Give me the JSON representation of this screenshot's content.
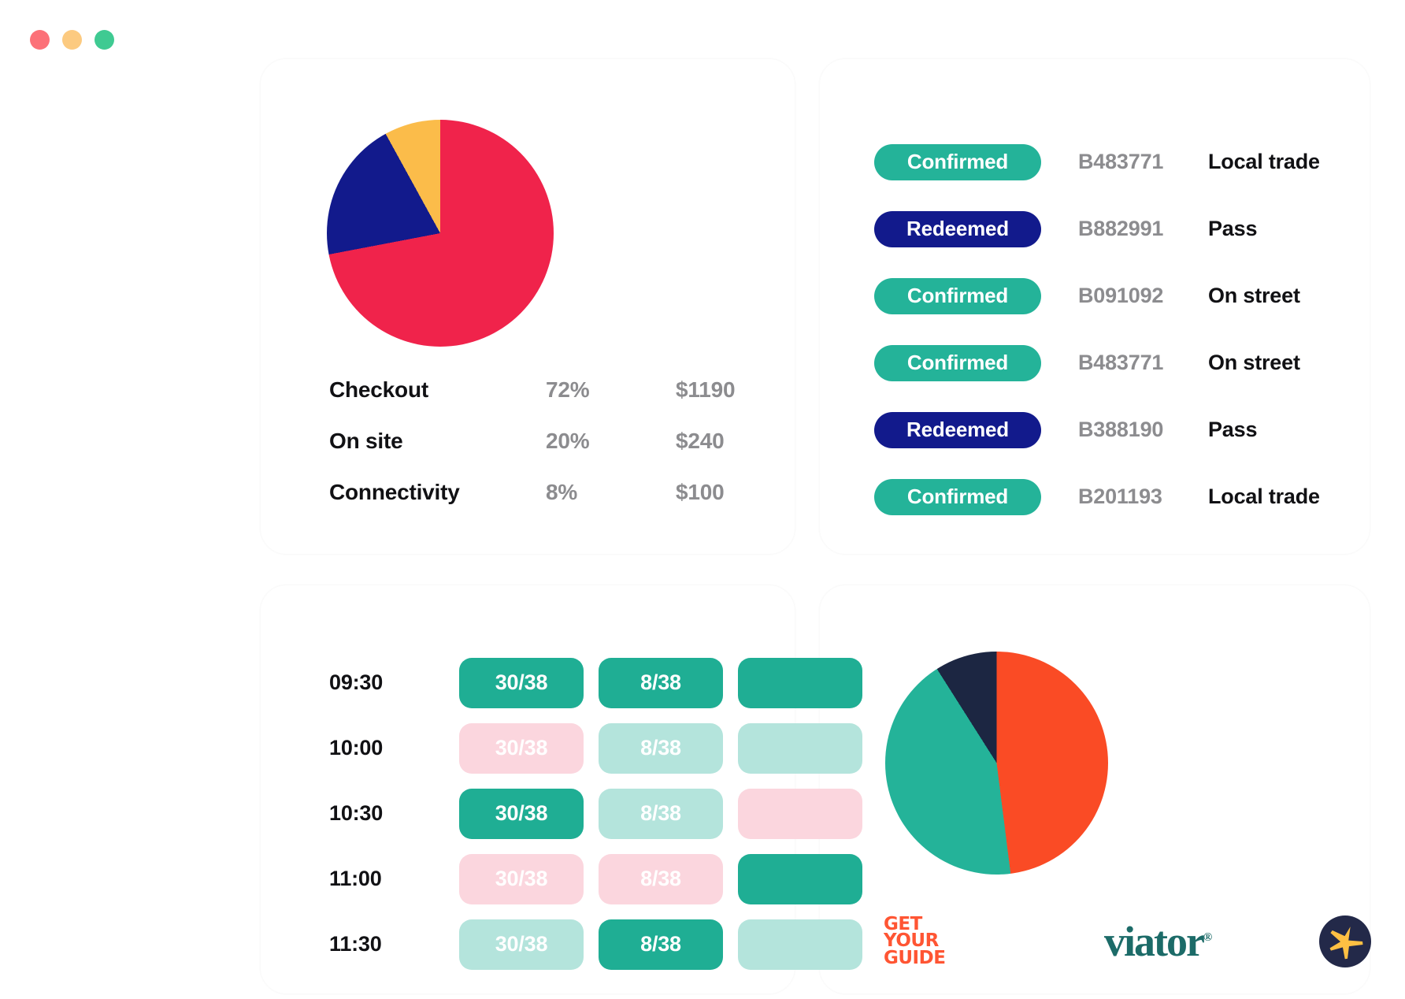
{
  "window": {
    "dots": [
      {
        "name": "close",
        "color": "#FC7178"
      },
      {
        "name": "minimize",
        "color": "#FCCA80"
      },
      {
        "name": "maximize",
        "color": "#3FCA92"
      }
    ]
  },
  "palette": {
    "crimson": "#F0234B",
    "navy": "#121A8C",
    "amber": "#FBBC4A",
    "teal": "#24B399",
    "teal_deep": "#1FAE94",
    "teal_soft": "#B4E4DC",
    "pink_soft": "#FBD6DE",
    "orange": "#FA4B25",
    "dark_navy": "#1C2642",
    "grey_text": "#8C8C8F",
    "black_text": "#111114"
  },
  "revenue": {
    "rows": [
      {
        "label": "Checkout",
        "percent": "72%",
        "amount": "$1190"
      },
      {
        "label": "On site",
        "percent": "20%",
        "amount": "$240"
      },
      {
        "label": "Connectivity",
        "percent": "8%",
        "amount": "$100"
      }
    ]
  },
  "bookings": {
    "rows": [
      {
        "status": "Confirmed",
        "status_kind": "confirmed",
        "ref": "B483771",
        "type": "Local trade"
      },
      {
        "status": "Redeemed",
        "status_kind": "redeemed",
        "ref": "B882991",
        "type": "Pass"
      },
      {
        "status": "Confirmed",
        "status_kind": "confirmed",
        "ref": "B091092",
        "type": "On street"
      },
      {
        "status": "Confirmed",
        "status_kind": "confirmed",
        "ref": "B483771",
        "type": "On street"
      },
      {
        "status": "Redeemed",
        "status_kind": "redeemed",
        "ref": "B388190",
        "type": "Pass"
      },
      {
        "status": "Confirmed",
        "status_kind": "confirmed",
        "ref": "B201193",
        "type": "Local trade"
      }
    ]
  },
  "capacity": {
    "rows": [
      {
        "time": "09:30",
        "cells": [
          {
            "value": "30/38",
            "state": "full"
          },
          {
            "value": "8/38",
            "state": "full"
          },
          {
            "value": "",
            "state": "full"
          }
        ]
      },
      {
        "time": "10:00",
        "cells": [
          {
            "value": "30/38",
            "state": "pink"
          },
          {
            "value": "8/38",
            "state": "soft"
          },
          {
            "value": "",
            "state": "soft"
          }
        ]
      },
      {
        "time": "10:30",
        "cells": [
          {
            "value": "30/38",
            "state": "full"
          },
          {
            "value": "8/38",
            "state": "soft"
          },
          {
            "value": "",
            "state": "pink"
          }
        ]
      },
      {
        "time": "11:00",
        "cells": [
          {
            "value": "30/38",
            "state": "pink"
          },
          {
            "value": "8/38",
            "state": "pink"
          },
          {
            "value": "",
            "state": "full"
          }
        ]
      },
      {
        "time": "11:30",
        "cells": [
          {
            "value": "30/38",
            "state": "soft"
          },
          {
            "value": "8/38",
            "state": "full"
          },
          {
            "value": "",
            "state": "soft"
          }
        ]
      }
    ]
  },
  "partners": {
    "getyourguide": {
      "line1": "GET",
      "line2": "YOUR",
      "line3": "GUIDE",
      "name": "GetYourGuide"
    },
    "viator": {
      "text": "viator",
      "registered": "®"
    },
    "expedia": {
      "name": "plane-icon"
    }
  },
  "chart_data": [
    {
      "type": "pie",
      "title": "Revenue by channel",
      "categories": [
        "Checkout",
        "On site",
        "Connectivity"
      ],
      "values": [
        72,
        20,
        8
      ],
      "amounts": [
        1190,
        240,
        100
      ],
      "colors": [
        "#F0234B",
        "#121A8C",
        "#FBBC4A"
      ],
      "unit": "%",
      "legend": "below",
      "grid": false
    },
    {
      "type": "pie",
      "title": "Distribution channels",
      "categories": [
        "GetYourGuide",
        "Viator",
        "Expedia"
      ],
      "values": [
        48,
        43,
        9
      ],
      "colors": [
        "#FA4B25",
        "#24B399",
        "#1C2642"
      ],
      "unit": "%",
      "legend": "logos-below",
      "grid": false
    }
  ]
}
